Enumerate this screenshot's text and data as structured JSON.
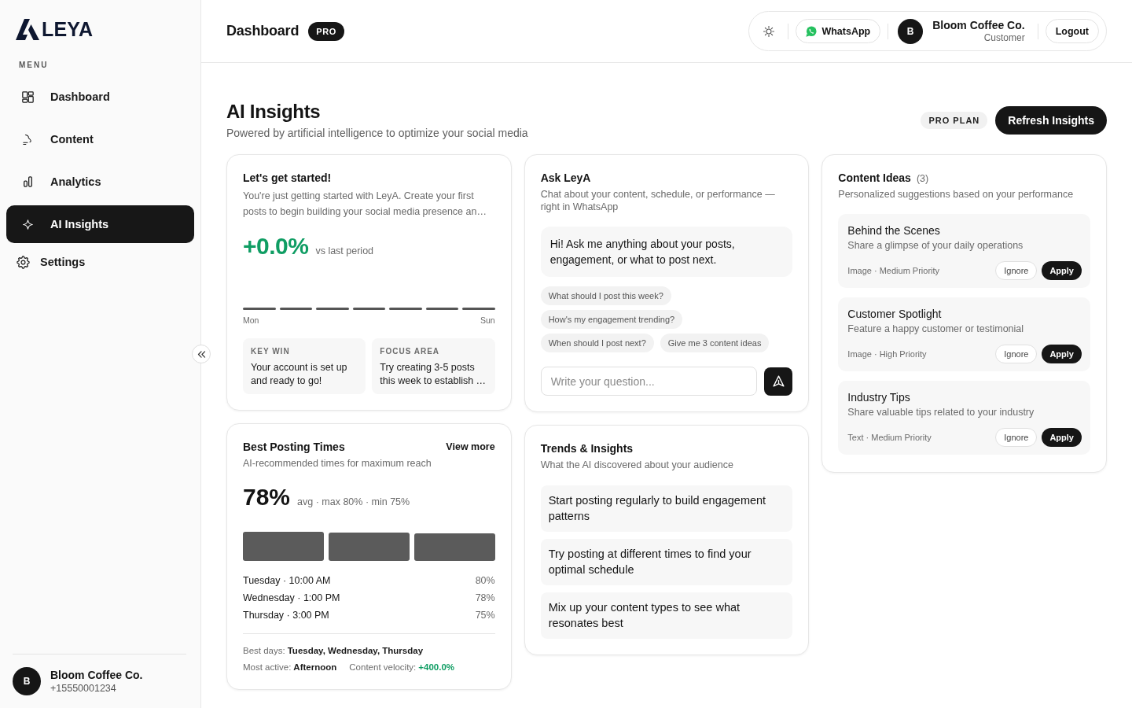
{
  "sidebar": {
    "brand": "LEYA",
    "menu_label": "MENU",
    "items": [
      {
        "label": "Dashboard",
        "selected": false
      },
      {
        "label": "Content",
        "selected": false
      },
      {
        "label": "Analytics",
        "selected": false
      },
      {
        "label": "AI Insights",
        "selected": true
      }
    ],
    "settings": {
      "label": "Settings"
    },
    "account": {
      "initial": "B",
      "name": "Bloom Coffee Co.",
      "phone": "+15550001234"
    }
  },
  "header": {
    "title": "Dashboard",
    "badge": "PRO",
    "whatsapp_button": "WhatsApp",
    "user": {
      "initial": "B",
      "name": "Bloom Coffee Co.",
      "role": "Customer"
    },
    "logout_button": "Logout"
  },
  "page": {
    "title": "AI Insights",
    "subtitle": "Powered by artificial intelligence to optimize your social media",
    "plan_badge": "PRO PLAN",
    "refresh_button": "Refresh Insights"
  },
  "getting_started": {
    "title": "Let's get started!",
    "description": "You're just getting started with LeyA. Create your first posts to begin building your social media presence an…",
    "change": {
      "value": "+0.0%",
      "positive": true,
      "note": "vs last period"
    },
    "range_start": "Mon",
    "range_end": "Sun",
    "highlights": [
      {
        "label": "KEY WIN",
        "text": "Your account is set up and ready to go!"
      },
      {
        "label": "FOCUS AREA",
        "text": "Try creating 3-5 posts this week to establish …"
      }
    ]
  },
  "posting_times": {
    "title": "Best Posting Times",
    "link": "View more",
    "description": "AI-recommended times for maximum reach",
    "value": "78%",
    "value_note": "avg · max 80% · min 75%",
    "slots": [
      {
        "label": "Tuesday · 10:00 AM",
        "share": "80%"
      },
      {
        "label": "Wednesday · 1:00 PM",
        "share": "78%"
      },
      {
        "label": "Thursday · 3:00 PM",
        "share": "75%"
      }
    ],
    "stats": [
      [
        {
          "label": "Best days:",
          "value": "Tuesday, Wednesday, Thursday",
          "positive": false
        }
      ],
      [
        {
          "label": "Most active:",
          "value": "Afternoon",
          "positive": false
        },
        {
          "label": "Content velocity:",
          "value": "+400.0%",
          "positive": true
        }
      ]
    ]
  },
  "ask": {
    "title": "Ask LeyA",
    "description": "Chat about your content, schedule, or performance — right in WhatsApp",
    "message": "Hi! Ask me anything about your posts, engagement, or what to post next.",
    "suggestions": [
      "What should I post this week?",
      "How's my engagement trending?",
      "When should I post next?",
      "Give me 3 content ideas"
    ],
    "input": {
      "placeholder": "Write your question..."
    }
  },
  "trends": {
    "title": "Trends & Insights",
    "description": "What the AI discovered about your audience",
    "items": [
      "Start posting regularly to build engagement patterns",
      "Try posting at different times to find your optimal schedule",
      "Mix up your content types to see what resonates best"
    ]
  },
  "content_ideas": {
    "title": "Content Ideas",
    "count": "(3)",
    "description": "Personalized suggestions based on your performance",
    "ideas": [
      {
        "title": "Behind the Scenes",
        "description": "Share a glimpse of your daily operations",
        "meta": "Image · Medium Priority",
        "ignore_button": "Ignore",
        "apply_button": "Apply"
      },
      {
        "title": "Customer Spotlight",
        "description": "Feature a happy customer or testimonial",
        "meta": "Image · High Priority",
        "ignore_button": "Ignore",
        "apply_button": "Apply"
      },
      {
        "title": "Industry Tips",
        "description": "Share valuable tips related to your industry",
        "meta": "Text · Medium Priority",
        "ignore_button": "Ignore",
        "apply_button": "Apply"
      }
    ]
  }
}
